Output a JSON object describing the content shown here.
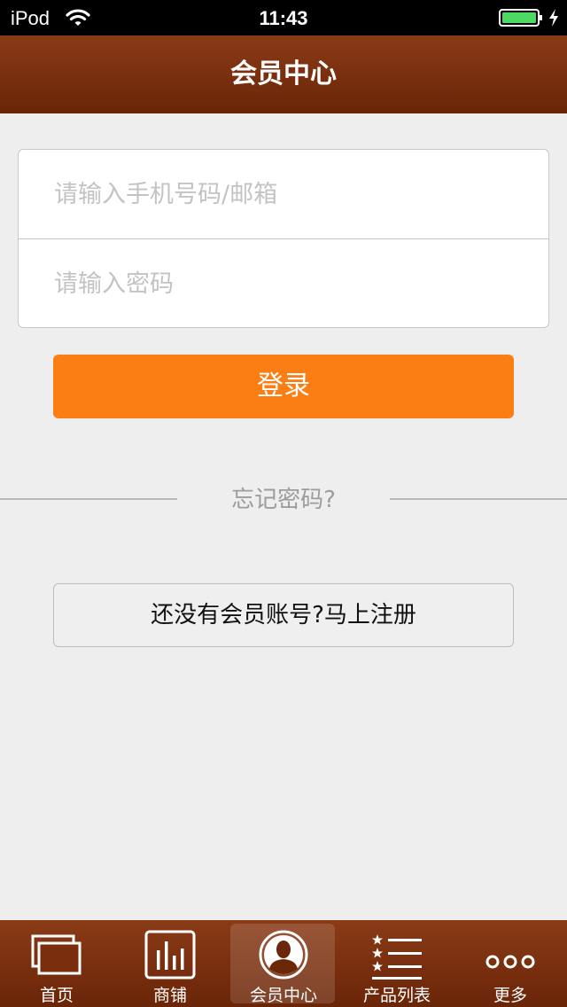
{
  "status_bar": {
    "carrier": "iPod",
    "time": "11:43",
    "wifi_icon": "wifi-icon",
    "battery_icon": "battery-icon",
    "charging_icon": "bolt-icon"
  },
  "header": {
    "title": "会员中心"
  },
  "login_form": {
    "username_placeholder": "请输入手机号码/邮箱",
    "username_value": "",
    "password_placeholder": "请输入密码",
    "password_value": "",
    "login_label": "登录",
    "forgot_label": "忘记密码?",
    "register_label": "还没有会员账号?马上注册"
  },
  "tabbar": {
    "active_index": 2,
    "items": [
      {
        "label": "首页",
        "icon": "home-icon"
      },
      {
        "label": "商铺",
        "icon": "bar-chart-icon"
      },
      {
        "label": "会员中心",
        "icon": "user-icon"
      },
      {
        "label": "产品列表",
        "icon": "star-list-icon"
      },
      {
        "label": "更多",
        "icon": "more-icon"
      }
    ]
  },
  "colors": {
    "header_bg": "#7b3010",
    "accent": "#fb7e14",
    "background": "#eeeeee",
    "battery": "#4cd964"
  }
}
